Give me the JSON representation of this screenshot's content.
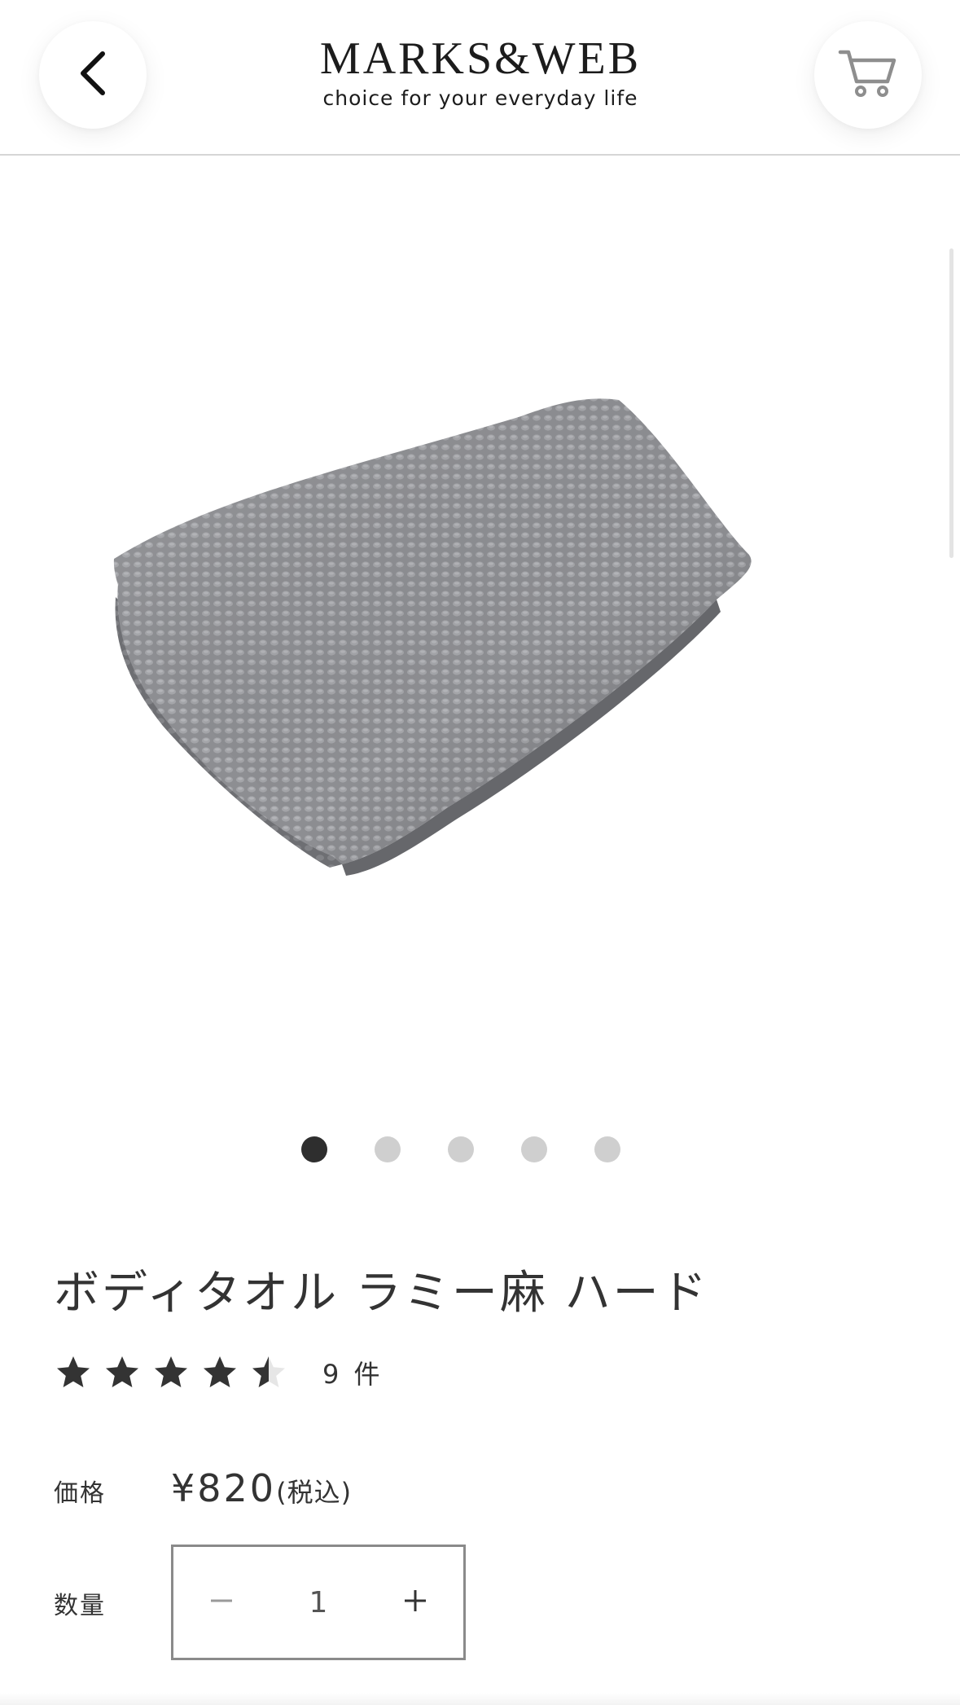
{
  "header": {
    "brand_name": "MARKS&WEB",
    "tagline": "choice for your everyday life",
    "back_icon": "chevron-left-icon",
    "cart_icon": "cart-icon"
  },
  "gallery": {
    "image_description_icon": "product-photo",
    "page_count": 5,
    "active_page": 1
  },
  "product": {
    "title": "ボディタオル ラミー麻 ハード",
    "rating": 4.5,
    "rating_max": 5,
    "review_count": "9 件",
    "price_label": "価格",
    "price": "¥820",
    "price_tax_note": "(税込)",
    "quantity_label": "数量",
    "quantity": "1"
  },
  "colors": {
    "text": "#333333",
    "star": "#333333",
    "star_empty": "#e0e0e0",
    "dot_active": "#2e2e2e",
    "dot_inactive": "#cfcfcf",
    "stepper_border": "#8a8a8a"
  }
}
